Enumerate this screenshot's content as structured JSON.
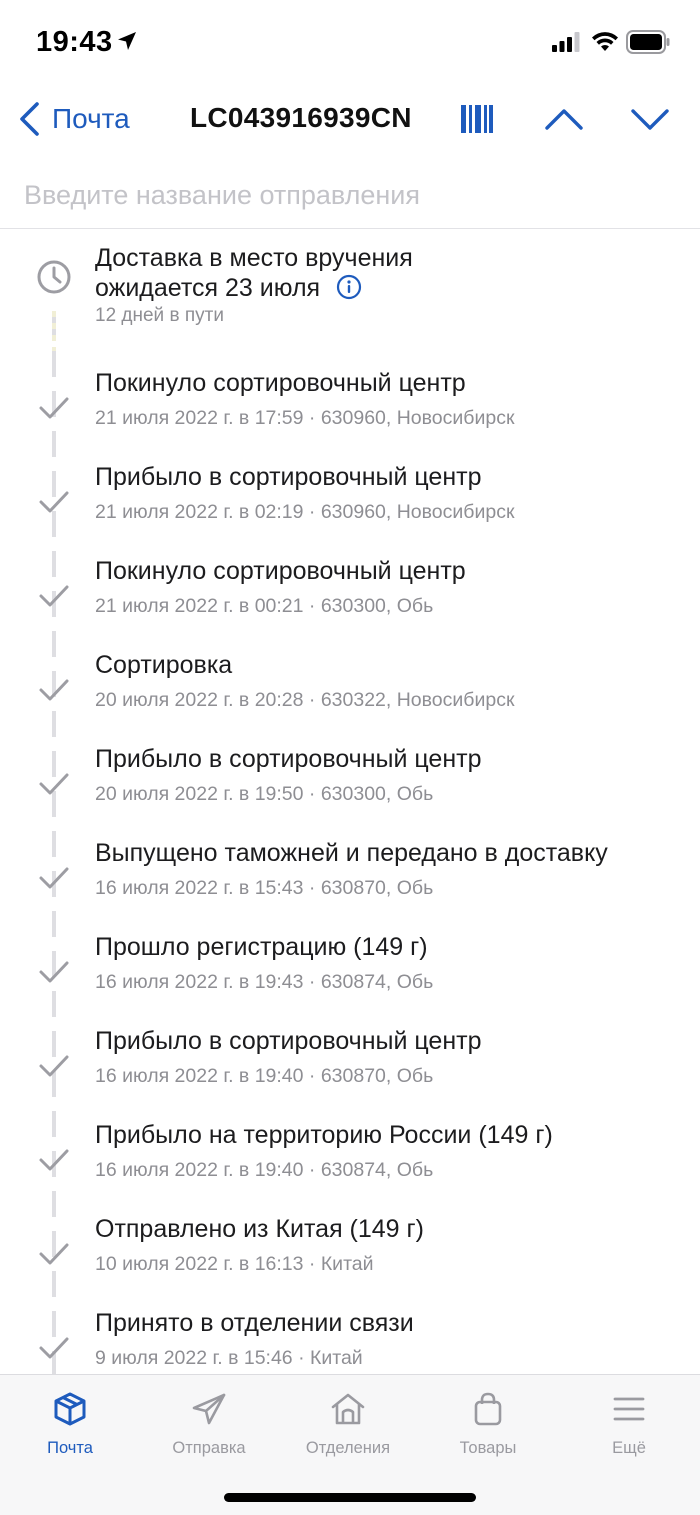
{
  "status_bar": {
    "time": "19:43"
  },
  "nav": {
    "back_label": "Почта",
    "title": "LC043916939CN"
  },
  "search": {
    "placeholder": "Введите название отправления"
  },
  "forecast": {
    "title_line1": "Доставка в место вручения",
    "title_line2": "ожидается 23 июля",
    "subtitle": "12 дней в пути"
  },
  "events": [
    {
      "title": "Покинуло сортировочный центр",
      "meta": "21 июля 2022 г. в 17:59 · 630960, Новосибирск"
    },
    {
      "title": "Прибыло в сортировочный центр",
      "meta": "21 июля 2022 г. в 02:19 · 630960, Новосибирск"
    },
    {
      "title": "Покинуло сортировочный центр",
      "meta": "21 июля 2022 г. в 00:21 · 630300, Обь"
    },
    {
      "title": "Сортировка",
      "meta": "20 июля 2022 г. в 20:28 · 630322, Новосибирск"
    },
    {
      "title": "Прибыло в сортировочный центр",
      "meta": "20 июля 2022 г. в 19:50 · 630300, Обь"
    },
    {
      "title": "Выпущено таможней и передано в доставку",
      "meta": "16 июля 2022 г. в 15:43 · 630870, Обь"
    },
    {
      "title": "Прошло регистрацию  (149 г)",
      "meta": "16 июля 2022 г. в 19:43 · 630874, Обь"
    },
    {
      "title": "Прибыло в сортировочный центр",
      "meta": "16 июля 2022 г. в 19:40 · 630870, Обь"
    },
    {
      "title": "Прибыло на территорию России  (149 г)",
      "meta": "16 июля 2022 г. в 19:40 · 630874, Обь"
    },
    {
      "title": "Отправлено из Китая  (149 г)",
      "meta": "10 июля 2022 г. в 16:13 · Китай"
    },
    {
      "title": "Принято в отделении связи",
      "meta": "9 июля 2022 г. в 15:46 · Китай"
    }
  ],
  "tabs": [
    {
      "label": "Почта",
      "icon": "box-icon",
      "active": true
    },
    {
      "label": "Отправка",
      "icon": "paper-plane-icon",
      "active": false
    },
    {
      "label": "Отделения",
      "icon": "house-icon",
      "active": false
    },
    {
      "label": "Товары",
      "icon": "shopping-bag-icon",
      "active": false
    },
    {
      "label": "Ещё",
      "icon": "menu-icon",
      "active": false
    }
  ],
  "colors": {
    "accent": "#1e5bbd",
    "muted": "#8e8e93",
    "check": "#9d9da3"
  }
}
